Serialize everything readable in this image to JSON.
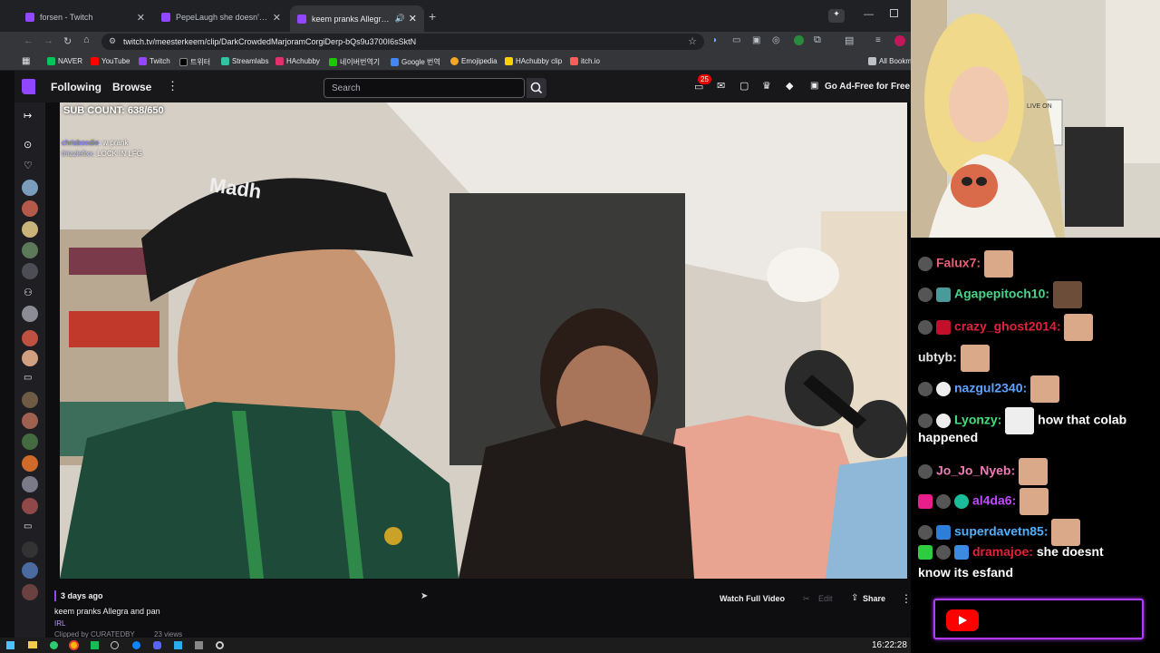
{
  "browser": {
    "tabs": [
      {
        "title": "forsen - Twitch"
      },
      {
        "title": "PepeLaugh she doesn't know -"
      },
      {
        "title": "keem pranks Allegra and pa"
      }
    ],
    "url": "twitch.tv/meesterkeem/clip/DarkCrowdedMarjoramCorgiDerp-bQs9u3700I6sSktN",
    "bookmarks": [
      "NAVER",
      "YouTube",
      "Twitch",
      "트위터",
      "Streamlabs",
      "HAchubby",
      "네이버번역기",
      "Google 번역",
      "Emojipedia",
      "HAchubby clip",
      "itch.io"
    ],
    "all_bookmarks": "All Bookm"
  },
  "twitch": {
    "following": "Following",
    "browse": "Browse",
    "search_placeholder": "Search",
    "notification_count": "25",
    "ad_free": "Go Ad-Free for Free"
  },
  "video": {
    "sub_count": "SUB COUNT: 638/650",
    "overlay_chat": [
      {
        "user": "chrisboodie",
        "text": "w prank"
      },
      {
        "user": "thizzlefixx",
        "text": "LOCK IN LFG"
      }
    ],
    "hat_text": "Madh"
  },
  "clip": {
    "age": "3 days ago",
    "title": "keem pranks Allegra and pan",
    "category": "IRL",
    "clipped_by": "Clipped by CURATEDBY",
    "views": "23 views",
    "watch_full": "Watch Full Video",
    "edit": "Edit",
    "share": "Share"
  },
  "taskbar": {
    "time": "16:22:28"
  },
  "stream_overlay": {
    "live_sign": "LIVE ON"
  },
  "chat": [
    {
      "user": "Falux7:",
      "color": "#e85f74",
      "text": ""
    },
    {
      "user": "Agapepitoch10:",
      "color": "#49d48b",
      "text": ""
    },
    {
      "user": "crazy_ghost2014:",
      "color": "#e0223b",
      "text": ""
    },
    {
      "user": "ubtyb:",
      "color": "#e8e8e8",
      "text": ""
    },
    {
      "user": "nazgul2340:",
      "color": "#5fa2ff",
      "text": ""
    },
    {
      "user": "Lyonzy:",
      "color": "#3fe07a",
      "text": "how that colab"
    },
    {
      "user": "",
      "color": "#fff",
      "text": "happened"
    },
    {
      "user": "Jo_Jo_Nyeb:",
      "color": "#f07ab6",
      "text": ""
    },
    {
      "user": "al4da6:",
      "color": "#c34bff",
      "text": ""
    },
    {
      "user": "superdavetn85:",
      "color": "#4fb0ff",
      "text": ""
    },
    {
      "user": "dramajoe:",
      "color": "#e0223b",
      "text": "she doesnt"
    },
    {
      "user": "",
      "color": "#fff",
      "text": "know its esfand"
    }
  ]
}
